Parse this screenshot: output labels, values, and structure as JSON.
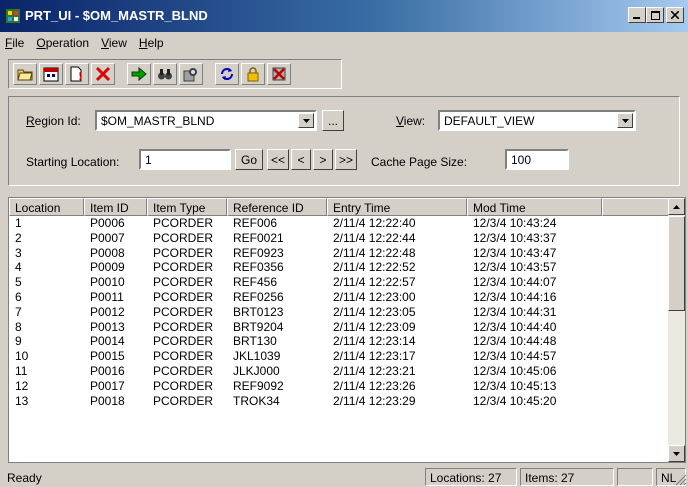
{
  "window": {
    "title": "PRT_UI - $OM_MASTR_BLND"
  },
  "menu": [
    {
      "label_pre": "",
      "label_ul": "F",
      "label_post": "ile"
    },
    {
      "label_pre": "",
      "label_ul": "O",
      "label_post": "peration"
    },
    {
      "label_pre": "",
      "label_ul": "V",
      "label_post": "iew"
    },
    {
      "label_pre": "",
      "label_ul": "H",
      "label_post": "elp"
    }
  ],
  "toolbar": {
    "icons": [
      "open-folder-icon",
      "calendar-icon",
      "new-document-icon",
      "delete-icon",
      "go-arrow-icon",
      "find-icon",
      "find-next-icon",
      "refresh-icon",
      "lock-icon",
      "clear-icon"
    ]
  },
  "criteria": {
    "region_label_ul": "R",
    "region_label_rest": "egion Id:",
    "region_value": "$OM_MASTR_BLND",
    "browse_label": "...",
    "view_label_ul": "V",
    "view_label_rest": "iew:",
    "view_value": "DEFAULT_VIEW",
    "start_label": "Starting Location:",
    "start_value": "1",
    "go_label": "Go",
    "nav": [
      "<<",
      "<",
      ">",
      ">>"
    ],
    "cache_label": "Cache Page Size:",
    "cache_value": "100"
  },
  "grid": {
    "columns": [
      "Location",
      "Item ID",
      "Item Type",
      "Reference ID",
      "Entry Time",
      "Mod Time"
    ],
    "rows": [
      [
        "1",
        "P0006",
        "PCORDER",
        "REF006",
        "2/11/4 12:22:40",
        "12/3/4 10:43:24"
      ],
      [
        "2",
        "P0007",
        "PCORDER",
        "REF0021",
        "2/11/4 12:22:44",
        "12/3/4 10:43:37"
      ],
      [
        "3",
        "P0008",
        "PCORDER",
        "REF0923",
        "2/11/4 12:22:48",
        "12/3/4 10:43:47"
      ],
      [
        "4",
        "P0009",
        "PCORDER",
        "REF0356",
        "2/11/4 12:22:52",
        "12/3/4 10:43:57"
      ],
      [
        "5",
        "P0010",
        "PCORDER",
        "REF456",
        "2/11/4 12:22:57",
        "12/3/4 10:44:07"
      ],
      [
        "6",
        "P0011",
        "PCORDER",
        "REF0256",
        "2/11/4 12:23:00",
        "12/3/4 10:44:16"
      ],
      [
        "7",
        "P0012",
        "PCORDER",
        "BRT0123",
        "2/11/4 12:23:05",
        "12/3/4 10:44:31"
      ],
      [
        "8",
        "P0013",
        "PCORDER",
        "BRT9204",
        "2/11/4 12:23:09",
        "12/3/4 10:44:40"
      ],
      [
        "9",
        "P0014",
        "PCORDER",
        "BRT130",
        "2/11/4 12:23:14",
        "12/3/4 10:44:48"
      ],
      [
        "10",
        "P0015",
        "PCORDER",
        "JKL1039",
        "2/11/4 12:23:17",
        "12/3/4 10:44:57"
      ],
      [
        "11",
        "P0016",
        "PCORDER",
        "JLKJ000",
        "2/11/4 12:23:21",
        "12/3/4 10:45:06"
      ],
      [
        "12",
        "P0017",
        "PCORDER",
        "REF9092",
        "2/11/4 12:23:26",
        "12/3/4 10:45:13"
      ],
      [
        "13",
        "P0018",
        "PCORDER",
        "TROK34",
        "2/11/4 12:23:29",
        "12/3/4 10:45:20"
      ]
    ]
  },
  "status": {
    "text": "Ready",
    "locations": "Locations: 27",
    "items": "Items: 27",
    "empty": "",
    "nl": "NL"
  }
}
